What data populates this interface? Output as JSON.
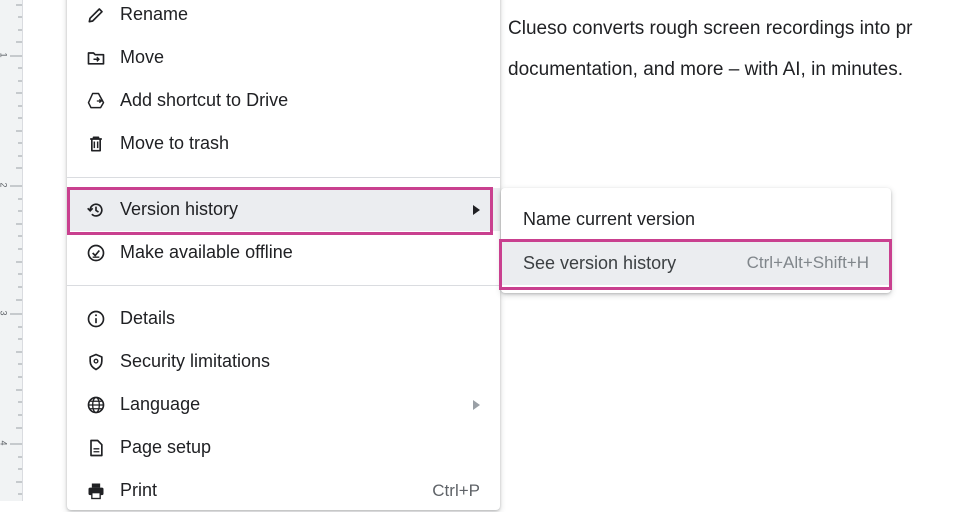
{
  "document": {
    "lines": [
      "Clueso converts rough screen recordings into pr",
      "documentation, and more – with AI, in minutes."
    ]
  },
  "ruler": {
    "marks": [
      "1",
      "2",
      "3",
      "4"
    ]
  },
  "menu": {
    "items": [
      {
        "label": "Rename",
        "icon": "pencil-icon"
      },
      {
        "label": "Move",
        "icon": "folder-move-icon"
      },
      {
        "label": "Add shortcut to Drive",
        "icon": "drive-shortcut-icon"
      },
      {
        "label": "Move to trash",
        "icon": "trash-icon"
      },
      {
        "label": "Version history",
        "icon": "history-icon",
        "submenu": true,
        "active": true
      },
      {
        "label": "Make available offline",
        "icon": "offline-icon"
      },
      {
        "label": "Details",
        "icon": "info-icon"
      },
      {
        "label": "Security limitations",
        "icon": "shield-icon"
      },
      {
        "label": "Language",
        "icon": "globe-icon",
        "submenu": true
      },
      {
        "label": "Page setup",
        "icon": "page-icon"
      },
      {
        "label": "Print",
        "icon": "printer-icon",
        "shortcut": "Ctrl+P"
      }
    ]
  },
  "submenu": {
    "items": [
      {
        "label": "Name current version"
      },
      {
        "label": "See version history",
        "shortcut": "Ctrl+Alt+Shift+H",
        "active": true
      }
    ]
  },
  "colors": {
    "highlight": "#c9408f",
    "hover": "#ebedf0",
    "text": "#202124",
    "muted": "#5f6368"
  }
}
